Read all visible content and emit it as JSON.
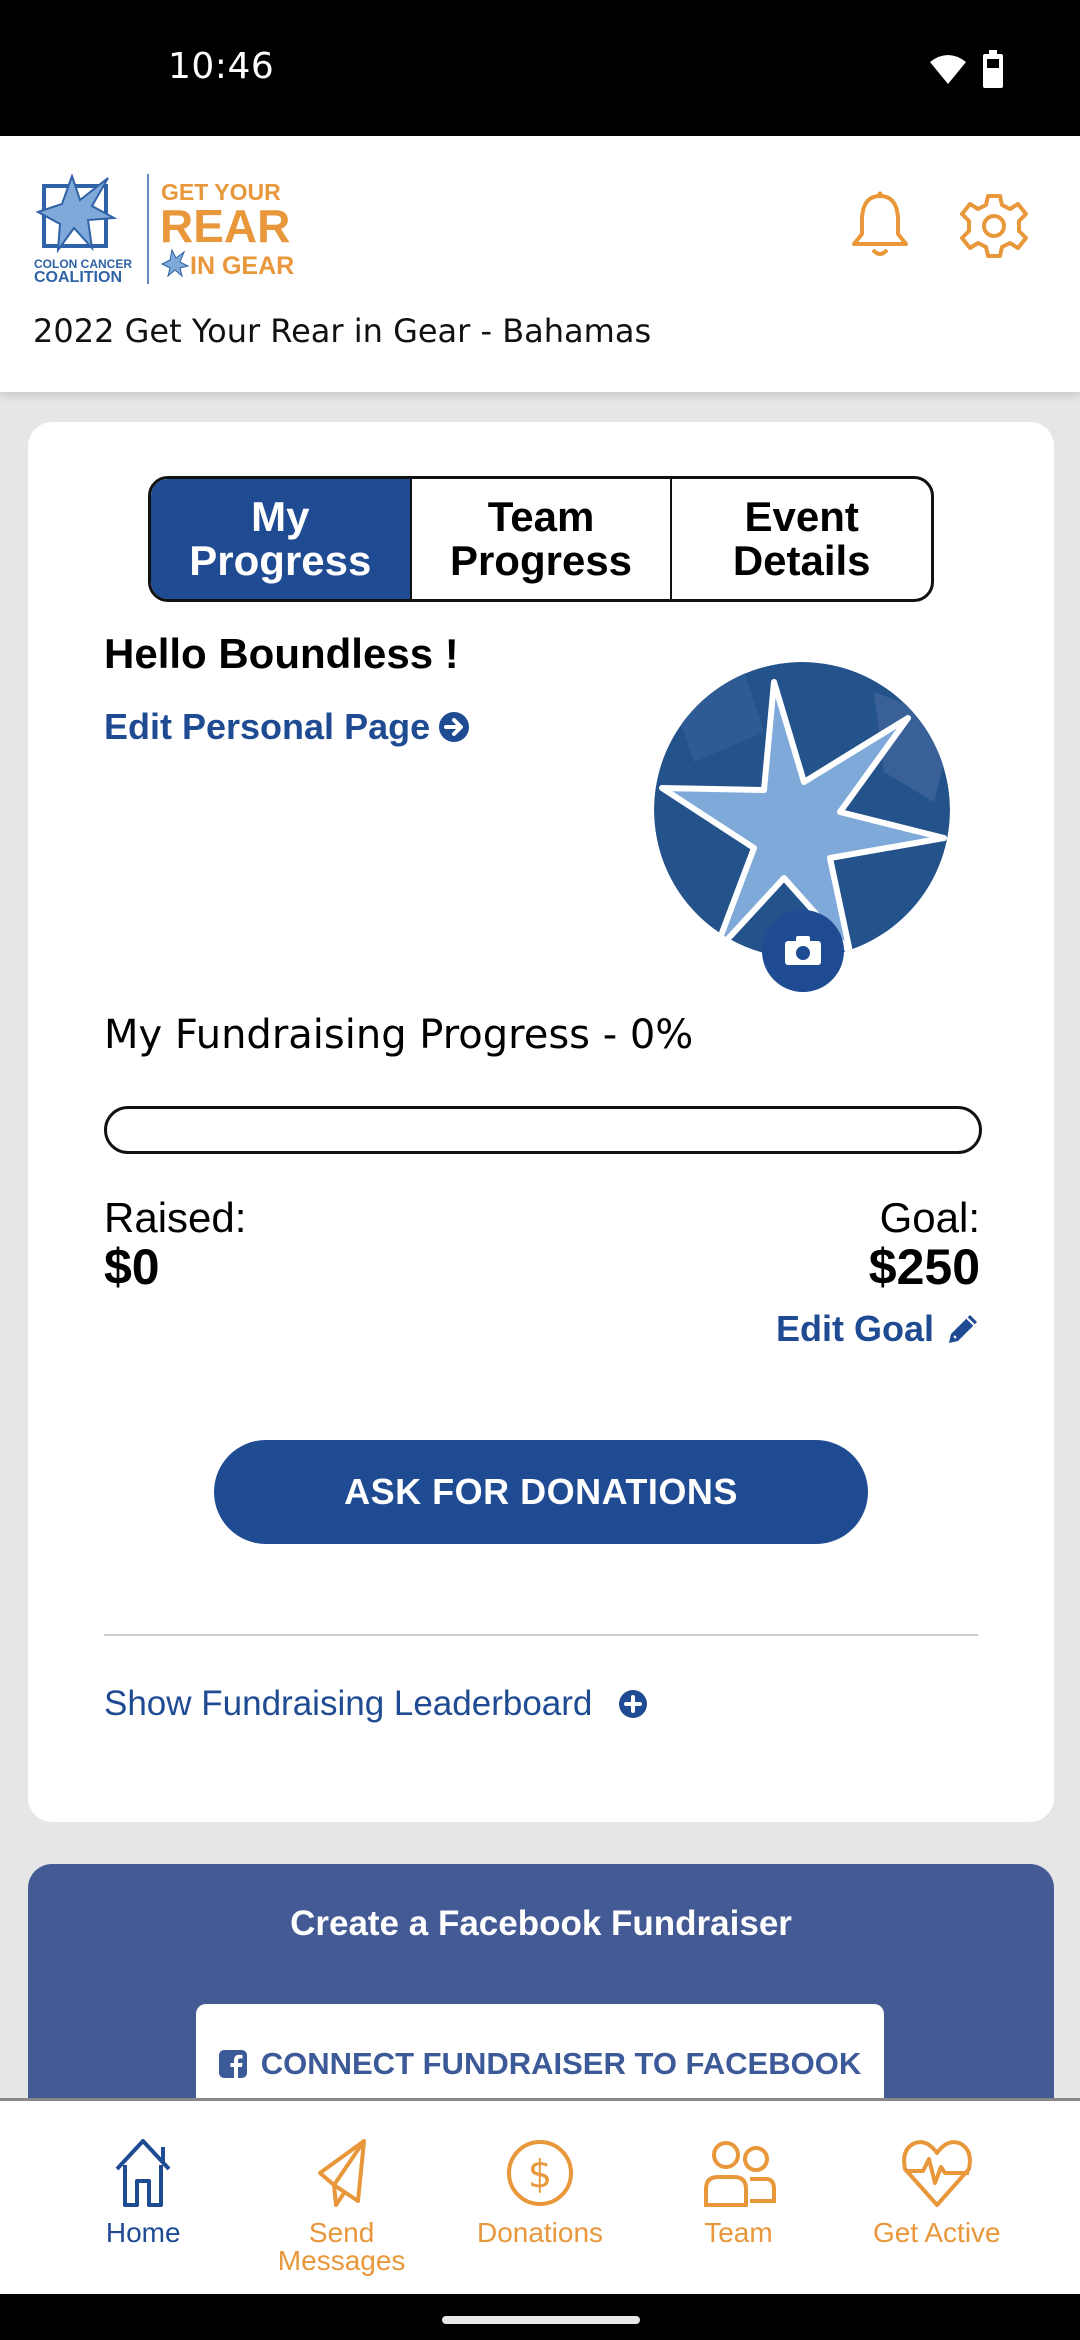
{
  "status_bar": {
    "time": "10:46",
    "icons": [
      "wifi-icon",
      "battery-icon"
    ]
  },
  "header": {
    "logo": {
      "org_line1": "COLON CANCER",
      "org_line2": "COALITION",
      "brand_line1": "GET YOUR",
      "brand_line2": "REAR",
      "brand_line3": "IN GEAR"
    },
    "event_title": "2022 Get Your Rear in Gear - Bahamas",
    "icons": [
      "bell-icon",
      "gear-icon"
    ]
  },
  "tabs": [
    {
      "label_line1": "My",
      "label_line2": "Progress",
      "active": true
    },
    {
      "label_line1": "Team",
      "label_line2": "Progress",
      "active": false
    },
    {
      "label_line1": "Event",
      "label_line2": "Details",
      "active": false
    }
  ],
  "profile": {
    "greeting": "Hello Boundless !",
    "edit_page_label": "Edit Personal Page"
  },
  "fundraising": {
    "title": "My Fundraising Progress - 0%",
    "progress_percent": 0,
    "raised_label": "Raised:",
    "raised_value": "$0",
    "goal_label": "Goal:",
    "goal_value": "$250",
    "edit_goal_label": "Edit Goal"
  },
  "actions": {
    "ask_button": "ASK FOR DONATIONS",
    "leaderboard_label": "Show Fundraising Leaderboard"
  },
  "facebook": {
    "title": "Create a Facebook Fundraiser",
    "button": "CONNECT FUNDRAISER TO FACEBOOK"
  },
  "bottom_nav": [
    {
      "line1": "Home",
      "line2": "",
      "icon": "home-icon",
      "active": true
    },
    {
      "line1": "Send",
      "line2": "Messages",
      "icon": "paper-plane-icon",
      "active": false
    },
    {
      "line1": "Donations",
      "line2": "",
      "icon": "dollar-circle-icon",
      "active": false
    },
    {
      "line1": "Team",
      "line2": "",
      "icon": "people-icon",
      "active": false
    },
    {
      "line1": "Get Active",
      "line2": "",
      "icon": "heart-pulse-icon",
      "active": false
    }
  ],
  "colors": {
    "primary": "#1f4b93",
    "accent": "#e8973b",
    "facebook": "#445a94"
  }
}
